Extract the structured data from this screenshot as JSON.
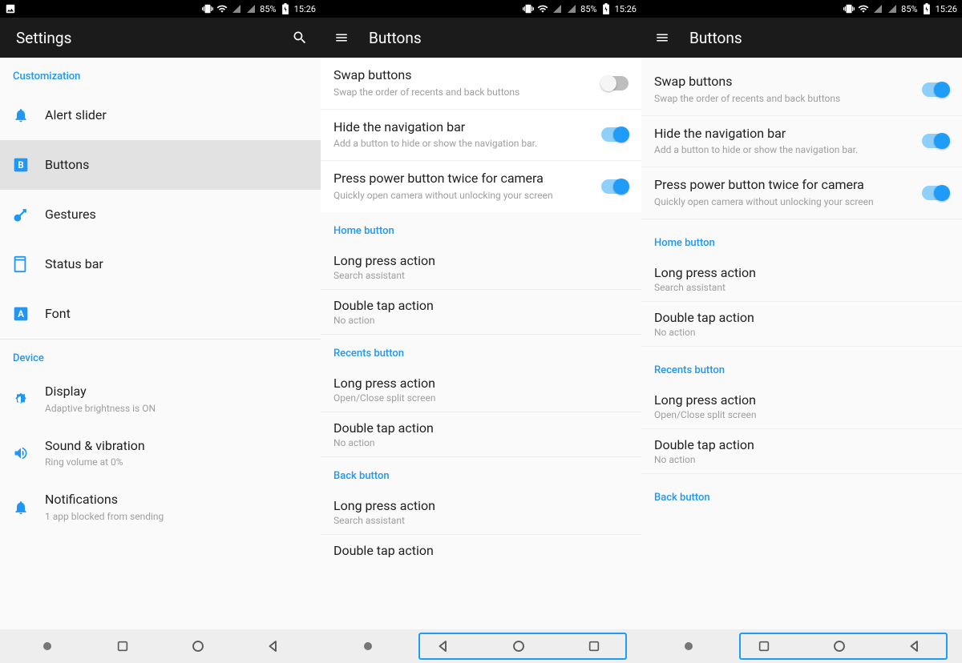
{
  "status": {
    "battery": "85%",
    "time": "15:26"
  },
  "screen1": {
    "title": "Settings",
    "sections": [
      {
        "header": "Customization"
      },
      {
        "header": "Device"
      }
    ],
    "items": {
      "alert_slider": "Alert slider",
      "buttons": "Buttons",
      "gestures": "Gestures",
      "status_bar": "Status bar",
      "font": "Font",
      "display": "Display",
      "display_sub": "Adaptive brightness is ON",
      "sound": "Sound & vibration",
      "sound_sub": "Ring volume at 0%",
      "notifications": "Notifications",
      "notifications_sub": "1 app blocked from sending"
    }
  },
  "screen2": {
    "title": "Buttons",
    "toggles": {
      "swap": {
        "label": "Swap buttons",
        "desc": "Swap the order of recents and back buttons",
        "on": false
      },
      "hidenav": {
        "label": "Hide the navigation bar",
        "desc": "Add a button to hide or show the navigation bar.",
        "on": true
      },
      "powercam": {
        "label": "Press power button twice for camera",
        "desc": "Quickly open camera without unlocking your screen",
        "on": true
      }
    },
    "home_header": "Home button",
    "recents_header": "Recents button",
    "back_header": "Back button",
    "actions": {
      "home_long": {
        "label": "Long press action",
        "value": "Search assistant"
      },
      "home_double": {
        "label": "Double tap action",
        "value": "No action"
      },
      "recents_long": {
        "label": "Long press action",
        "value": "Open/Close split screen"
      },
      "recents_double": {
        "label": "Double tap action",
        "value": "No action"
      },
      "back_long": {
        "label": "Long press action",
        "value": "Search assistant"
      },
      "back_double": {
        "label": "Double tap action"
      }
    }
  },
  "screen3": {
    "title": "Buttons",
    "toggles": {
      "swap": {
        "label": "Swap buttons",
        "desc": "Swap the order of recents and back buttons",
        "on": true
      },
      "hidenav": {
        "label": "Hide the navigation bar",
        "desc": "Add a button to hide or show the navigation bar.",
        "on": true
      },
      "powercam": {
        "label": "Press power button twice for camera",
        "desc": "Quickly open camera without unlocking your screen",
        "on": true
      }
    },
    "home_header": "Home button",
    "recents_header": "Recents button",
    "back_header": "Back button",
    "actions": {
      "home_long": {
        "label": "Long press action",
        "value": "Search assistant"
      },
      "home_double": {
        "label": "Double tap action",
        "value": "No action"
      },
      "recents_long": {
        "label": "Long press action",
        "value": "Open/Close split screen"
      },
      "recents_double": {
        "label": "Double tap action",
        "value": "No action"
      }
    }
  }
}
